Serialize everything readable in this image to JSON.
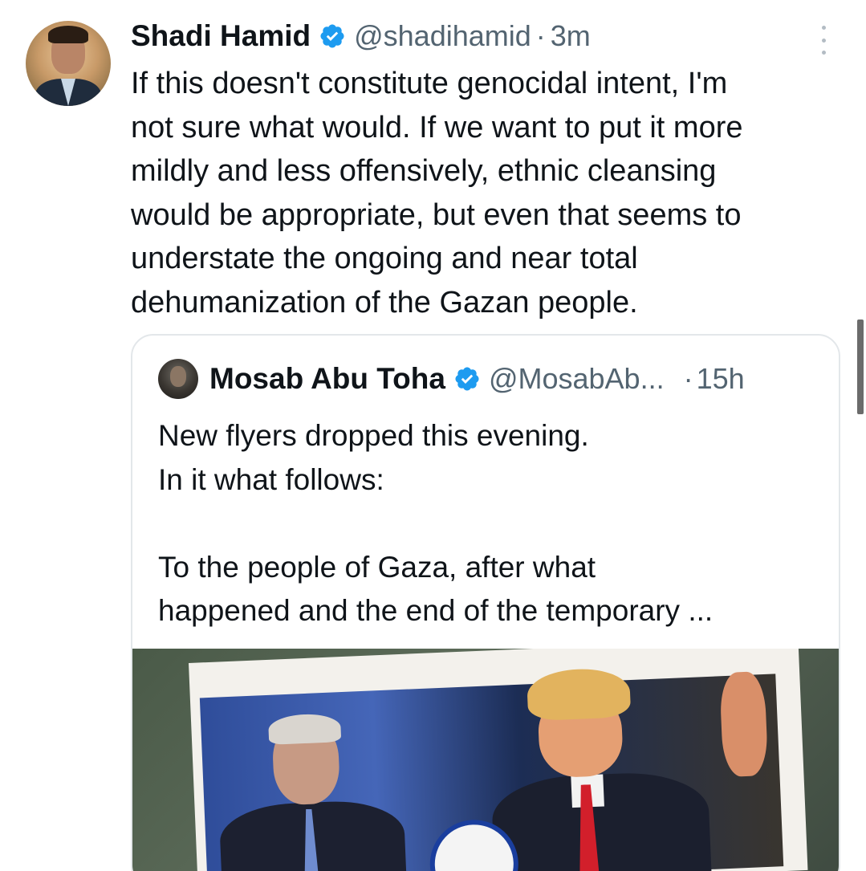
{
  "tweet": {
    "author_name": "Shadi Hamid",
    "handle": "@shadihamid",
    "separator": "·",
    "time": "3m",
    "text_lines": [
      "If this doesn't constitute genocidal intent, I'm",
      "not sure what would. If we want to put it more",
      "mildly and less offensively, ethnic cleansing",
      "would be appropriate, but even that seems to",
      "understate the ongoing and near total",
      "dehumanization of the Gazan people."
    ],
    "avatar_icon": "profile-photo",
    "more_icon": "more-vertical-icon"
  },
  "quote": {
    "author_name": "Mosab Abu Toha",
    "handle": "@MosabAb...",
    "separator": "·",
    "time": "15h",
    "text_lines": [
      "New flyers dropped this evening.",
      "In it what follows:",
      "",
      "To the people of Gaza, after what",
      "happened and the end of the temporary ..."
    ],
    "image_icon": "flyer-photo"
  },
  "colors": {
    "text_primary": "#0f1419",
    "text_secondary": "#536471",
    "verified_blue": "#1d9bf0",
    "border": "#e3e7ea"
  }
}
